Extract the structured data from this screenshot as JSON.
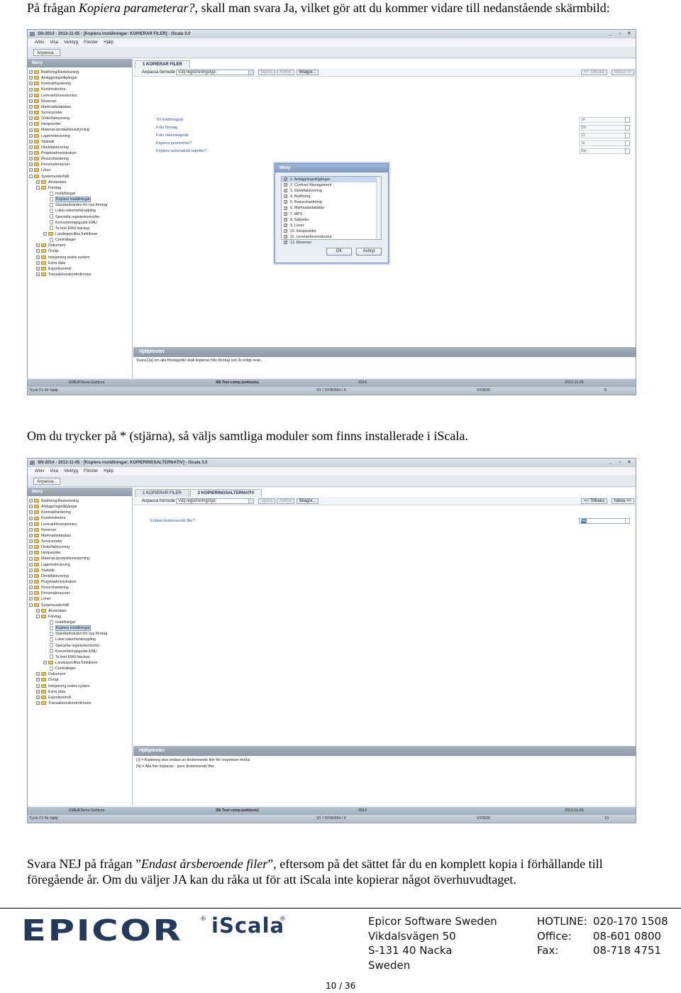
{
  "intro": {
    "prefix": "På frågan ",
    "question": "Kopiera parameterar?",
    "suffix": ", skall man svara Ja, vilket gör att du kommer vidare till nedanstående skärmbild:"
  },
  "shot1": {
    "title": "SN-2014 - 2013-11-05 - [Kopiera inställningar: KOPIERAR FILER] - iScala 3.0",
    "window_controls": "_ ▫ ×",
    "menu": [
      "Arkiv",
      "Visa",
      "Verktyg",
      "Fönster",
      "Hjälp"
    ],
    "anpassa": "Anpassa...",
    "meny_header": "Meny",
    "tree": [
      {
        "label": "Bokföring/Redovisning",
        "level": 0,
        "type": "folder",
        "tog": "+"
      },
      {
        "label": "Anläggningstillgångar",
        "level": 0,
        "type": "folder",
        "tog": "+"
      },
      {
        "label": "Kontrakthantering",
        "level": 0,
        "type": "folder",
        "tog": "+"
      },
      {
        "label": "Kundreskontra",
        "level": 0,
        "type": "folder",
        "tog": "+"
      },
      {
        "label": "Leverantörsreskontra",
        "level": 0,
        "type": "folder",
        "tog": "+"
      },
      {
        "label": "Reverser",
        "level": 0,
        "type": "folder",
        "tog": "+"
      },
      {
        "label": "Marknadsdatabas",
        "level": 0,
        "type": "folder",
        "tog": "+"
      },
      {
        "label": "Serviceorder",
        "level": 0,
        "type": "folder",
        "tog": "+"
      },
      {
        "label": "Order/fakturering",
        "level": 0,
        "type": "folder",
        "tog": "+"
      },
      {
        "label": "Inköpsorder",
        "level": 0,
        "type": "folder",
        "tog": "+"
      },
      {
        "label": "Material-/produktionsstyrning",
        "level": 0,
        "type": "folder",
        "tog": "+"
      },
      {
        "label": "Lagerredovisning",
        "level": 0,
        "type": "folder",
        "tog": "+"
      },
      {
        "label": "Statistik",
        "level": 0,
        "type": "folder",
        "tog": "+"
      },
      {
        "label": "Direktfakturering",
        "level": 0,
        "type": "folder",
        "tog": "+"
      },
      {
        "label": "Projektadministration",
        "level": 0,
        "type": "folder",
        "tog": "+"
      },
      {
        "label": "Resurshantering",
        "level": 0,
        "type": "folder",
        "tog": "+"
      },
      {
        "label": "Personalresurser",
        "level": 0,
        "type": "folder",
        "tog": "+"
      },
      {
        "label": "Löner",
        "level": 0,
        "type": "folder",
        "tog": "+"
      },
      {
        "label": "Systemunderhåll",
        "level": 0,
        "type": "folder",
        "tog": "-"
      },
      {
        "label": "Användare",
        "level": 1,
        "type": "folder",
        "tog": "+"
      },
      {
        "label": "Företag",
        "level": 1,
        "type": "folder",
        "tog": "-"
      },
      {
        "label": "Inställningar",
        "level": 2,
        "type": "doc",
        "tog": ""
      },
      {
        "label": "Kopiera inställningar",
        "level": 2,
        "type": "doc",
        "tog": "",
        "selected": true
      },
      {
        "label": "Standardvärden för nya företag",
        "level": 2,
        "type": "doc",
        "tog": ""
      },
      {
        "label": "Lokal säkerhetskoppling",
        "level": 2,
        "type": "doc",
        "tog": ""
      },
      {
        "label": "Speciella registerkontroller",
        "level": 2,
        "type": "doc",
        "tog": ""
      },
      {
        "label": "Konverteringsguide EMU",
        "level": 2,
        "type": "doc",
        "tog": ""
      },
      {
        "label": "Ta bort EMU-backup",
        "level": 2,
        "type": "doc",
        "tog": ""
      },
      {
        "label": "Landsspecifika funktioner",
        "level": 2,
        "type": "folder",
        "tog": "+"
      },
      {
        "label": "Centrallager",
        "level": 2,
        "type": "doc",
        "tog": ""
      },
      {
        "label": "Dokument",
        "level": 1,
        "type": "folder",
        "tog": "+"
      },
      {
        "label": "Övrigt",
        "level": 1,
        "type": "folder",
        "tog": "+"
      },
      {
        "label": "Integrering andra system",
        "level": 1,
        "type": "folder",
        "tog": "+"
      },
      {
        "label": "Extra data",
        "level": 1,
        "type": "folder",
        "tog": "+"
      },
      {
        "label": "Exportkontroll",
        "level": 1,
        "type": "folder",
        "tog": "+"
      },
      {
        "label": "Transaktionskontrollmotor",
        "level": 1,
        "type": "folder",
        "tog": "+"
      }
    ],
    "tab_active": "1 KOPIERAR FILER",
    "toolbar": {
      "anpassa_formular": "Anpassa formulär",
      "combo": "Välj registreringstyp:",
      "btn1": "Spara",
      "btn2": "Avbryt",
      "btn3": "Bilagor...",
      "prev": "<< Tillbaka",
      "next": "Nästa >>"
    },
    "questions": [
      "Till bokföringsår",
      "Från företag",
      "Från räkenskapsår",
      "Kopiera parametrar?",
      "Kopiera automatiskt tabeller?"
    ],
    "answers": [
      "14",
      "SN",
      "13",
      "Ja",
      "Nej"
    ],
    "help_header": "Hjälptexter",
    "help_lines": [
      "Svara [Ja] om alla företagsfält skall kopieras från företag och år enligt ovan."
    ],
    "dialog": {
      "title": "Meny",
      "items": [
        "1. Anläggningstillgångar",
        "2. Contract Management",
        "3. Direktfakturering",
        "4. Bokföring",
        "5. Resurshantering",
        "6. Marknadsdatabas",
        "7. MPS",
        "8. Säljorder",
        "9. Löner",
        "10. Inköpsorder",
        "11. Leverantörsreskontra",
        "12. Reverser"
      ],
      "check": "✓",
      "ok": "OK",
      "cancel": "Avbryt"
    },
    "status": {
      "user": "EMEA\\Terez.Gubicza",
      "company": "SN Test comp (exklusiv)",
      "year": "2014",
      "date": "2013-11-05",
      "hint": "Tryck F1 för hjälp",
      "sy": "SY / SY0020H / 4",
      "code": "SY0020",
      "num": "9"
    }
  },
  "mid_text": "Om du trycker på * (stjärna), så väljs samtliga moduler som finns installerade i iScala.",
  "shot2": {
    "title": "SN-2014 - 2013-11-05 - [Kopiera inställningar: KOPIERINGSALTERNATIV] - iScala 3.0",
    "tab1": "1 KOPIERAR FILER",
    "tab2": "2 KOPIERINGSALTERNATIV",
    "question": "Endast årsberoende filer?",
    "answer": "Nej",
    "help_lines": [
      "[J] = Kopiering sker endast av årsberoende filer för respektive modul.",
      "[N] = Alla filer kopieras - även årsberoende filer."
    ],
    "status": {
      "sy": "SY / SY0020H / 9",
      "num": "10"
    }
  },
  "closing": {
    "p1": "Svara NEJ på frågan ”",
    "q": "Endast årsberoende filer",
    "p2": "”, eftersom på det sättet får du en komplett kopia i förhållande till",
    "line2": "föregående år. Om du väljer JA kan du råka ut för att iScala inte kopierar något överhuvudtaget."
  },
  "footer": {
    "logo_text": "EPICOR",
    "reg": "®",
    "product": "iScala",
    "company_lines": [
      "Epicor Software Sweden",
      "Vikdalsvägen 50",
      "S-131 40 Nacka",
      "Sweden"
    ],
    "labels": [
      "HOTLINE:",
      "Office:",
      "Fax:"
    ],
    "numbers": [
      "020-170 1508",
      "08-601 0800",
      "08-718 4751"
    ],
    "page": "10 / 36"
  },
  "colors": {
    "brand": "#233a5c",
    "link": "#2a55a6",
    "selection": "#c7d9f0"
  }
}
